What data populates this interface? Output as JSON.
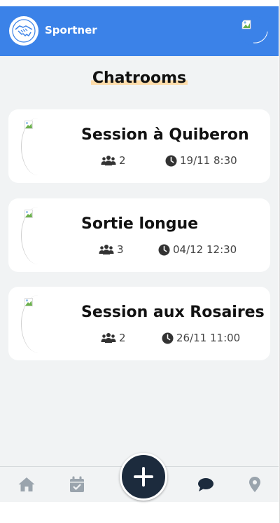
{
  "app": {
    "name": "Sportner"
  },
  "page": {
    "title": "Chatrooms"
  },
  "chatrooms": [
    {
      "title": "Session à Quiberon",
      "participants": "2",
      "datetime": "19/11 8:30"
    },
    {
      "title": "Sortie longue",
      "participants": "3",
      "datetime": "04/12 12:30"
    },
    {
      "title": "Session aux Rosaires",
      "participants": "2",
      "datetime": "26/11 11:00"
    }
  ],
  "icons": {
    "logo": "handshake-icon",
    "participants": "users-icon",
    "time": "clock-icon",
    "nav": [
      "home-icon",
      "calendar-check-icon",
      "plus-icon",
      "chat-icon",
      "map-marker-icon"
    ]
  },
  "colors": {
    "header": "#3b82e8",
    "background": "#f1f3f4",
    "fab": "#1c2b3d",
    "active_nav": "#1c2b3d",
    "inactive_nav": "#9aa4ad",
    "title_highlight": "#fddcaa"
  }
}
